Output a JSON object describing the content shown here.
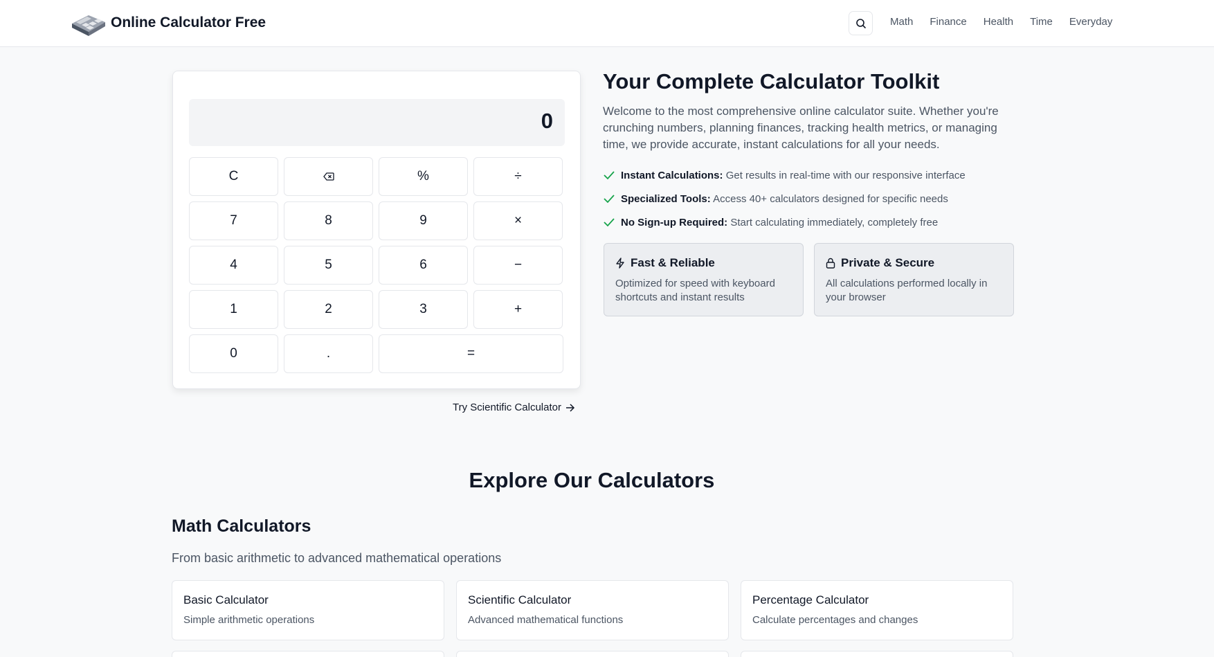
{
  "header": {
    "title": "Online Calculator Free",
    "nav": [
      "Math",
      "Finance",
      "Health",
      "Time",
      "Everyday"
    ]
  },
  "calculator": {
    "display": "0",
    "keys": {
      "clear": "C",
      "backspace": "⌫",
      "percent": "%",
      "divide": "÷",
      "seven": "7",
      "eight": "8",
      "nine": "9",
      "multiply": "×",
      "four": "4",
      "five": "5",
      "six": "6",
      "minus": "−",
      "one": "1",
      "two": "2",
      "three": "3",
      "plus": "+",
      "zero": "0",
      "decimal": ".",
      "equals": "="
    },
    "try_link": "Try Scientific Calculator"
  },
  "hero": {
    "title": "Your Complete Calculator Toolkit",
    "description": "Welcome to the most comprehensive online calculator suite. Whether you're crunching numbers, planning finances, tracking health metrics, or managing time, we provide accurate, instant calculations for all your needs.",
    "features": [
      {
        "label": "Instant Calculations:",
        "text": "Get results in real-time with our responsive interface"
      },
      {
        "label": "Specialized Tools:",
        "text": "Access 40+ calculators designed for specific needs"
      },
      {
        "label": "No Sign-up Required:",
        "text": "Start calculating immediately, completely free"
      }
    ],
    "cards": [
      {
        "title": "Fast & Reliable",
        "desc": "Optimized for speed with keyboard shortcuts and instant results"
      },
      {
        "title": "Private & Secure",
        "desc": "All calculations performed locally in your browser"
      }
    ]
  },
  "explore": {
    "title": "Explore Our Calculators",
    "math_title": "Math Calculators",
    "math_desc": "From basic arithmetic to advanced mathematical operations",
    "tiles": [
      {
        "title": "Basic Calculator",
        "desc": "Simple arithmetic operations"
      },
      {
        "title": "Scientific Calculator",
        "desc": "Advanced mathematical functions"
      },
      {
        "title": "Percentage Calculator",
        "desc": "Calculate percentages and changes"
      }
    ]
  },
  "colors": {
    "accent_check": "#16a34a",
    "text_primary": "#111827",
    "text_secondary": "#4b5563"
  }
}
